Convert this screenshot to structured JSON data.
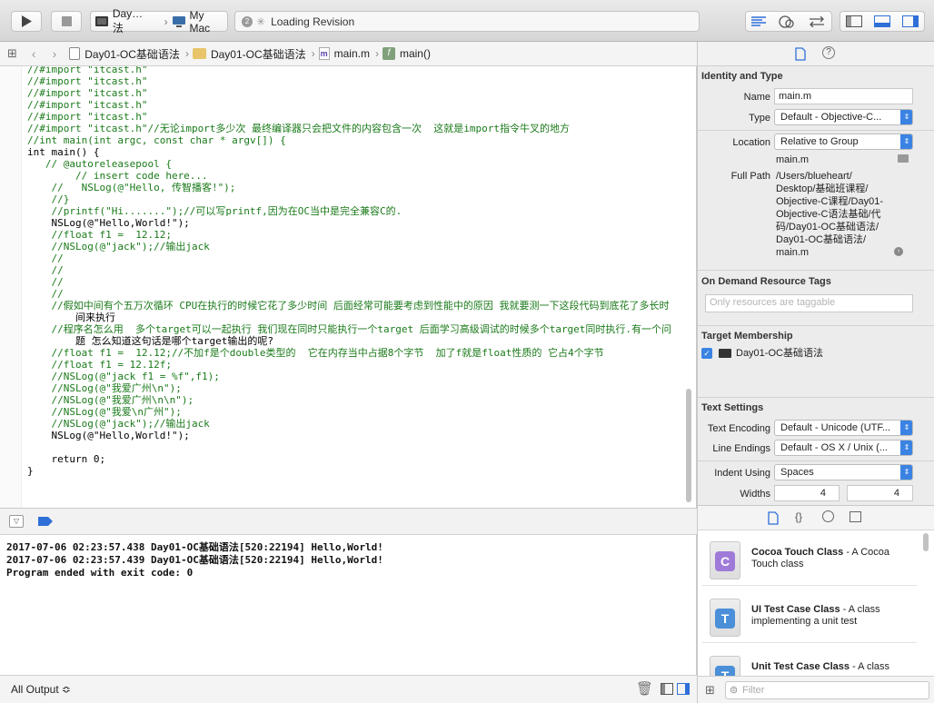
{
  "toolbar": {
    "scheme": "Day…法",
    "device": "My Mac",
    "activity_count": "2",
    "activity": "Loading Revision"
  },
  "jumpbar": {
    "items": [
      "Day01-OC基础语法",
      "Day01-OC基础语法",
      "main.m",
      "main()"
    ],
    "file_prefix": "m",
    "func_prefix": "f"
  },
  "code": [
    "//#import \"itcast.h\"",
    "//#import \"itcast.h\"",
    "//#import \"itcast.h\"",
    "//#import \"itcast.h\"",
    "//#import \"itcast.h\"",
    "//#import \"itcast.h\"//无论import多少次 最终编译器只会把文件的内容包含一次  这就是import指令牛叉的地方",
    "//int main(int argc, const char * argv[]) {",
    "int main() {",
    "   // @autoreleasepool {",
    "        // insert code here...",
    "    //   NSLog(@\"Hello, 传智播客!\");",
    "    //}",
    "    //printf(\"Hi.......\");//可以写printf,因为在OC当中是完全兼容C的.",
    "    NSLog(@\"Hello,World!\");",
    "    //float f1 =  12.12;",
    "    //NSLog(@\"jack\");//输出jack",
    "    //",
    "    //",
    "    //",
    "    //",
    "    //假如中间有个五万次循环 CPU在执行的时候它花了多少时间 后面经常可能要考虑到性能中的原因 我就要测一下这段代码到底花了多长时",
    "        间来执行",
    "    //程序名怎么用  多个target可以一起执行 我们现在同时只能执行一个target 后面学习高级调试的时候多个target同时执行.有一个问",
    "        题 怎么知道这句话是哪个target输出的呢?",
    "    //float f1 =  12.12;//不加f是个double类型的  它在内存当中占据8个字节  加了f就是float性质的 它占4个字节",
    "    //float f1 = 12.12f;",
    "    //NSLog(@\"jack f1 = %f\",f1);",
    "    //NSLog(@\"我爱广州\\n\");",
    "    //NSLog(@\"我爱广州\\n\\n\");",
    "    //NSLog(@\"我爱\\n广州\");",
    "    //NSLog(@\"jack\");//输出jack",
    "    NSLog(@\"Hello,World!\");",
    "",
    "    return 0;",
    "}"
  ],
  "console": {
    "lines": [
      "2017-07-06 02:23:57.438 Day01-OC基础语法[520:22194] Hello,World!",
      "2017-07-06 02:23:57.439 Day01-OC基础语法[520:22194] Hello,World!",
      "Program ended with exit code: 0"
    ],
    "output_selector": "All Output ≎",
    "filter_placeholder": "Filter"
  },
  "inspector": {
    "identity_title": "Identity and Type",
    "name_label": "Name",
    "name_value": "main.m",
    "type_label": "Type",
    "type_value": "Default - Objective-C...",
    "location_label": "Location",
    "location_value": "Relative to Group",
    "location_file": "main.m",
    "fullpath_label": "Full Path",
    "fullpath_lines": [
      "/Users/blueheart/",
      "Desktop/基础班课程/",
      "Objective-C课程/Day01-",
      "Objective-C语法基础/代",
      "码/Day01-OC基础语法/",
      "Day01-OC基础语法/",
      "main.m"
    ],
    "odr_title": "On Demand Resource Tags",
    "odr_placeholder": "Only resources are taggable",
    "target_title": "Target Membership",
    "target_name": "Day01-OC基础语法",
    "text_title": "Text Settings",
    "encoding_label": "Text Encoding",
    "encoding_value": "Default - Unicode (UTF...",
    "endings_label": "Line Endings",
    "endings_value": "Default - OS X / Unix (...",
    "indent_label": "Indent Using",
    "indent_value": "Spaces",
    "widths_label": "Widths",
    "width_tab": "4",
    "width_indent": "4"
  },
  "library": {
    "items": [
      {
        "icon": "C",
        "color": "#a07ad8",
        "title": "Cocoa Touch Class",
        "desc": " - A Cocoa Touch class"
      },
      {
        "icon": "T",
        "color": "#4a8fd8",
        "title": "UI Test Case Class",
        "desc": " - A class implementing a unit test"
      },
      {
        "icon": "T",
        "color": "#4a8fd8",
        "title": "Unit Test Case Class",
        "desc": " - A class"
      }
    ],
    "filter_placeholder": "Filter"
  }
}
